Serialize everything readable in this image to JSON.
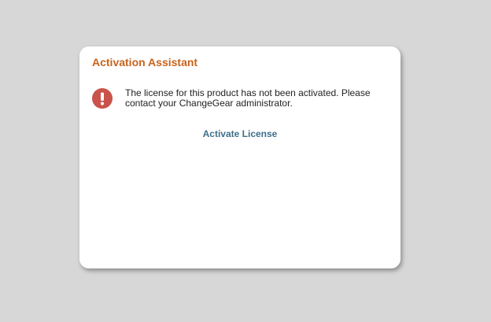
{
  "dialog": {
    "title": "Activation Assistant",
    "message": "The license for this product has not been activated. Please contact your ChangeGear administrator.",
    "action_label": "Activate License",
    "icon": "exclamation-circle-icon"
  },
  "colors": {
    "background": "#d7d7d7",
    "title": "#c8631c",
    "link": "#3f6f8a",
    "alert": "#c9534b"
  }
}
